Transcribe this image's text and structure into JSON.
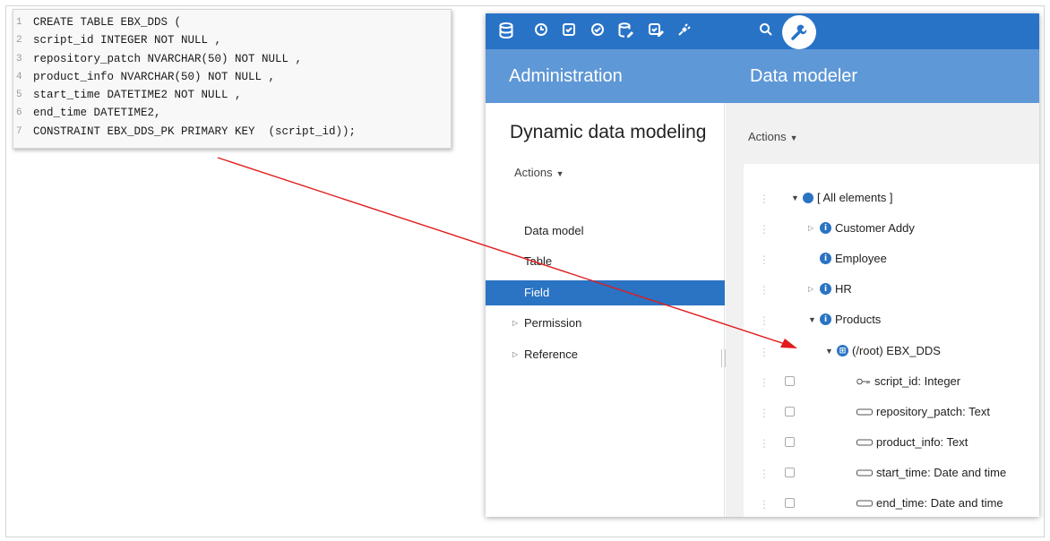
{
  "code": {
    "lines": [
      {
        "n": "1",
        "text": "CREATE TABLE EBX_DDS ("
      },
      {
        "n": "2",
        "text": "script_id INTEGER NOT NULL ,"
      },
      {
        "n": "3",
        "text": "repository_patch NVARCHAR(50) NOT NULL ,"
      },
      {
        "n": "4",
        "text": "product_info NVARCHAR(50) NOT NULL ,"
      },
      {
        "n": "5",
        "text": "start_time DATETIME2 NOT NULL ,"
      },
      {
        "n": "6",
        "text": "end_time DATETIME2,"
      },
      {
        "n": "7",
        "text": "CONSTRAINT EBX_DDS_PK PRIMARY KEY  (script_id));"
      }
    ]
  },
  "toolbar": {
    "icons": [
      "database-icon",
      "clock-icon",
      "check-square-icon",
      "check-circle-icon",
      "database-edit-icon",
      "check-edit-icon",
      "plug-icon",
      "search-icon",
      "wrench-icon"
    ]
  },
  "header": {
    "left_title": "Administration",
    "right_title": "Data modeler"
  },
  "left": {
    "title": "Dynamic data modeling",
    "actions": "Actions",
    "nav": [
      {
        "label": "Data model"
      },
      {
        "label": "Table"
      },
      {
        "label": "Field",
        "active": true
      },
      {
        "label": "Permission",
        "expandable": true
      },
      {
        "label": "Reference",
        "expandable": true
      }
    ]
  },
  "right": {
    "actions": "Actions",
    "tree": [
      {
        "label": "[ All elements ]"
      },
      {
        "label": "Customer Addy"
      },
      {
        "label": "Employee"
      },
      {
        "label": "HR"
      },
      {
        "label": "Products"
      },
      {
        "label": "(/root) EBX_DDS"
      },
      {
        "label": "script_id: Integer"
      },
      {
        "label": "repository_patch: Text"
      },
      {
        "label": "product_info: Text"
      },
      {
        "label": "start_time: Date and time"
      },
      {
        "label": "end_time: Date and time"
      }
    ]
  },
  "colors": {
    "toolbar": "#2973c7",
    "header": "#5f98d6",
    "active_nav": "#2b73c3",
    "arrow": "#e11b1b"
  }
}
